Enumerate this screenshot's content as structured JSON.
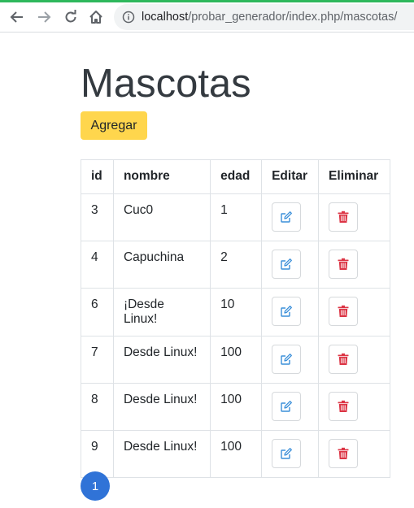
{
  "browser": {
    "url_host": "localhost",
    "url_path": "/probar_generador/index.php/mascotas/"
  },
  "page": {
    "title": "Mascotas",
    "add_button_label": "Agregar"
  },
  "table": {
    "headers": [
      "id",
      "nombre",
      "edad",
      "Editar",
      "Eliminar"
    ],
    "rows": [
      {
        "id": "3",
        "nombre": "Cuc0",
        "edad": "1"
      },
      {
        "id": "4",
        "nombre": "Capuchina",
        "edad": "2"
      },
      {
        "id": "6",
        "nombre": "¡Desde Linux!",
        "edad": "10"
      },
      {
        "id": "7",
        "nombre": "Desde Linux!",
        "edad": "100"
      },
      {
        "id": "8",
        "nombre": "Desde Linux!",
        "edad": "100"
      },
      {
        "id": "9",
        "nombre": "Desde Linux!",
        "edad": "100"
      }
    ]
  },
  "pagination": {
    "current_page": "1"
  },
  "icons": {
    "edit": "edit-icon",
    "delete": "trash-icon"
  },
  "colors": {
    "add_button": "#ffd64d",
    "edit_icon": "#3a8fd9",
    "delete_icon": "#dc3545",
    "page_button": "#3073d7",
    "load_bar": "#2eb85c"
  }
}
